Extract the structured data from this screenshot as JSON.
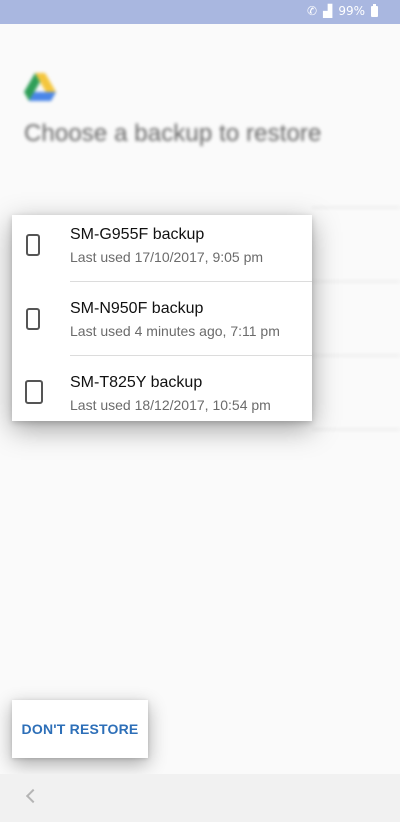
{
  "status_bar": {
    "battery_text": "99%",
    "icons": [
      "wifi-calling-icon",
      "signal-icon",
      "battery-icon"
    ]
  },
  "background": {
    "app_logo": "google-drive-logo-icon",
    "title": "Choose a backup to restore"
  },
  "backups": [
    {
      "name": "SM-G955F backup",
      "last_used": "Last used 17/10/2017, 9:05 pm",
      "icon": "phone-icon"
    },
    {
      "name": "SM-N950F backup",
      "last_used": "Last used 4 minutes ago, 7:11 pm",
      "icon": "phone-icon"
    },
    {
      "name": "SM-T825Y backup",
      "last_used": "Last used 18/12/2017, 10:54 pm",
      "icon": "tablet-icon"
    }
  ],
  "actions": {
    "dont_restore_label": "DON'T RESTORE"
  },
  "nav": {
    "back_icon": "chevron-left-icon"
  },
  "colors": {
    "status_bar": "#a9b7e0",
    "accent": "#2d6fb8",
    "background": "#fafafa"
  }
}
